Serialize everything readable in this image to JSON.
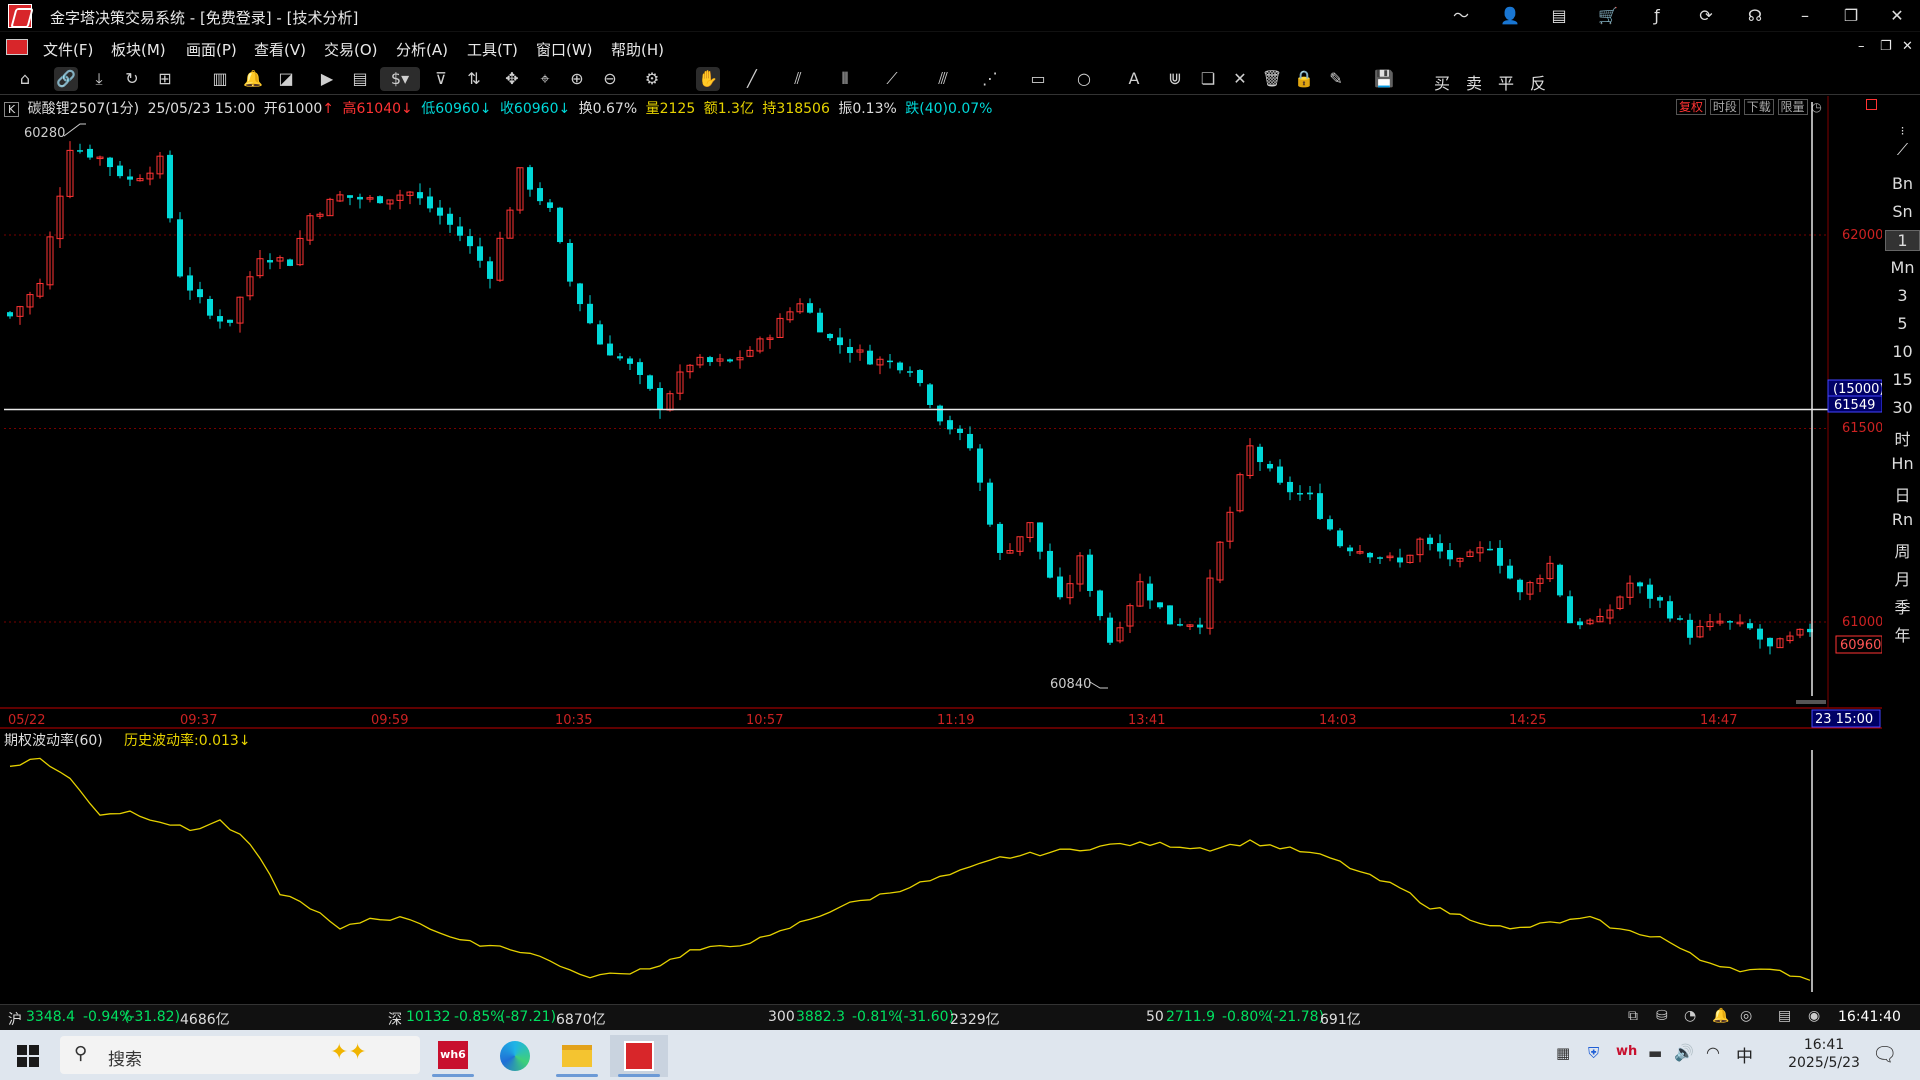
{
  "window": {
    "title": "金字塔决策交易系统 - [免费登录] - [技术分析]"
  },
  "menu": [
    "文件(F)",
    "板块(M)",
    "画面(P)",
    "查看(V)",
    "交易(O)",
    "分析(A)",
    "工具(T)",
    "窗口(W)",
    "帮助(H)"
  ],
  "toolbar": {
    "currency_label": "$",
    "trade_buttons": [
      "买",
      "卖",
      "平",
      "反"
    ]
  },
  "quote": {
    "k_label": "K",
    "symbol": "碳酸锂2507(1分)",
    "datetime": "25/05/23 15:00",
    "open": "开61000",
    "open_arrow": "↑",
    "high": "高61040",
    "high_arrow": "↓",
    "low": "低60960",
    "low_arrow": "↓",
    "close": "收60960",
    "close_arrow": "↓",
    "turnover": "换0.67%",
    "volume": "量2125",
    "amount": "额1.3亿",
    "open_interest": "持318506",
    "amplitude": "振0.13%",
    "change": "跌(40)0.07%",
    "right_buttons": [
      "复权",
      "时段",
      "下载",
      "限量"
    ]
  },
  "chart_labels": {
    "price_ticks": [
      "62000",
      "61500",
      "61000"
    ],
    "crosshair_volume": "(15000)",
    "crosshair_price": "61549",
    "last_price": "60960",
    "high_mark": "60280",
    "low_mark": "60840",
    "time_ticks": [
      "05/22",
      "09:37",
      "09:59",
      "10:35",
      "10:57",
      "11:19",
      "13:41",
      "14:03",
      "14:25",
      "14:47"
    ],
    "crosshair_time": "23 15:00",
    "indicator_name": "期权波动率(60)",
    "indicator_value": "历史波动率:0.013↓"
  },
  "right_panel": [
    "Bn",
    "Sn",
    "1",
    "Mn",
    "3",
    "5",
    "10",
    "15",
    "30",
    "时",
    "Hn",
    "日",
    "Rn",
    "周",
    "月",
    "季",
    "年"
  ],
  "status": {
    "sh_label": "沪",
    "sh_value": "3348.4",
    "sh_pct": "-0.94%",
    "sh_chg": "(-31.82)",
    "sh_amt": "4686亿",
    "sz_label": "深",
    "sz_value": "10132",
    "sz_pct": "-0.85%",
    "sz_chg": "(-87.21)",
    "sz_amt": "6870亿",
    "i300_label": "300",
    "i300_value": "3882.3",
    "i300_pct": "-0.81%",
    "i300_chg": "(-31.60)",
    "i300_amt": "2329亿",
    "i50_label": "50",
    "i50_value": "2711.9",
    "i50_pct": "-0.80%",
    "i50_chg": "(-21.78)",
    "i50_amt": "691亿",
    "time": "16:41:40"
  },
  "taskbar": {
    "search_placeholder": "搜索",
    "time": "16:41",
    "date": "2025/5/23",
    "ime": "中"
  },
  "colors": {
    "up": "#ff3333",
    "down": "#00d8d8",
    "indicator": "#e6d200",
    "grid": "#7a0000"
  },
  "chart_data": {
    "type": "candlestick",
    "y_ticks": [
      62000,
      61500,
      61000
    ],
    "x_ticks": [
      "05/22",
      "09:37",
      "09:59",
      "10:35",
      "10:57",
      "11:19",
      "13:41",
      "14:03",
      "14:25",
      "14:47"
    ],
    "price_anchors": [
      [
        0,
        61790
      ],
      [
        3,
        61870
      ],
      [
        6,
        62230
      ],
      [
        9,
        62200
      ],
      [
        12,
        62140
      ],
      [
        15,
        62190
      ],
      [
        17,
        61900
      ],
      [
        20,
        61790
      ],
      [
        22,
        61780
      ],
      [
        25,
        61950
      ],
      [
        28,
        61930
      ],
      [
        30,
        62050
      ],
      [
        33,
        62100
      ],
      [
        36,
        62090
      ],
      [
        40,
        62110
      ],
      [
        43,
        62050
      ],
      [
        45,
        62000
      ],
      [
        48,
        61900
      ],
      [
        51,
        62160
      ],
      [
        54,
        62060
      ],
      [
        56,
        61880
      ],
      [
        59,
        61720
      ],
      [
        62,
        61660
      ],
      [
        65,
        61560
      ],
      [
        68,
        61670
      ],
      [
        72,
        61670
      ],
      [
        75,
        61720
      ],
      [
        79,
        61830
      ],
      [
        82,
        61730
      ],
      [
        86,
        61680
      ],
      [
        90,
        61660
      ],
      [
        93,
        61530
      ],
      [
        96,
        61450
      ],
      [
        99,
        61170
      ],
      [
        102,
        61250
      ],
      [
        105,
        61050
      ],
      [
        107,
        61160
      ],
      [
        110,
        60950
      ],
      [
        113,
        61100
      ],
      [
        116,
        61000
      ],
      [
        119,
        61000
      ],
      [
        121,
        61200
      ],
      [
        124,
        61450
      ],
      [
        127,
        61350
      ],
      [
        130,
        61320
      ],
      [
        133,
        61200
      ],
      [
        136,
        61180
      ],
      [
        139,
        61150
      ],
      [
        141,
        61210
      ],
      [
        145,
        61150
      ],
      [
        148,
        61200
      ],
      [
        151,
        61070
      ],
      [
        154,
        61150
      ],
      [
        156,
        61000
      ],
      [
        159,
        61000
      ],
      [
        162,
        61100
      ],
      [
        165,
        61050
      ],
      [
        168,
        60970
      ],
      [
        171,
        61000
      ],
      [
        174,
        60980
      ],
      [
        176,
        60930
      ],
      [
        180,
        60980
      ]
    ],
    "indicator": {
      "name": "期权波动率(60)",
      "series_name": "历史波动率",
      "last_value": 0.013,
      "anchors": [
        [
          0,
          0.96
        ],
        [
          3,
          0.99
        ],
        [
          6,
          0.9
        ],
        [
          9,
          0.75
        ],
        [
          12,
          0.76
        ],
        [
          15,
          0.72
        ],
        [
          18,
          0.68
        ],
        [
          21,
          0.72
        ],
        [
          24,
          0.62
        ],
        [
          27,
          0.41
        ],
        [
          30,
          0.35
        ],
        [
          33,
          0.25
        ],
        [
          36,
          0.3
        ],
        [
          40,
          0.3
        ],
        [
          45,
          0.2
        ],
        [
          49,
          0.18
        ],
        [
          52,
          0.15
        ],
        [
          55,
          0.1
        ],
        [
          57,
          0.05
        ],
        [
          61,
          0.06
        ],
        [
          65,
          0.1
        ],
        [
          68,
          0.16
        ],
        [
          72,
          0.18
        ],
        [
          76,
          0.22
        ],
        [
          79,
          0.28
        ],
        [
          83,
          0.35
        ],
        [
          87,
          0.4
        ],
        [
          91,
          0.45
        ],
        [
          95,
          0.5
        ],
        [
          99,
          0.56
        ],
        [
          103,
          0.58
        ],
        [
          107,
          0.6
        ],
        [
          111,
          0.62
        ],
        [
          115,
          0.62
        ],
        [
          120,
          0.6
        ],
        [
          124,
          0.63
        ],
        [
          129,
          0.59
        ],
        [
          132,
          0.56
        ],
        [
          136,
          0.48
        ],
        [
          139,
          0.43
        ],
        [
          142,
          0.35
        ],
        [
          146,
          0.3
        ],
        [
          150,
          0.25
        ],
        [
          154,
          0.28
        ],
        [
          158,
          0.3
        ],
        [
          161,
          0.25
        ],
        [
          165,
          0.22
        ],
        [
          169,
          0.12
        ],
        [
          173,
          0.08
        ],
        [
          177,
          0.07
        ],
        [
          180,
          0.04
        ]
      ]
    }
  }
}
